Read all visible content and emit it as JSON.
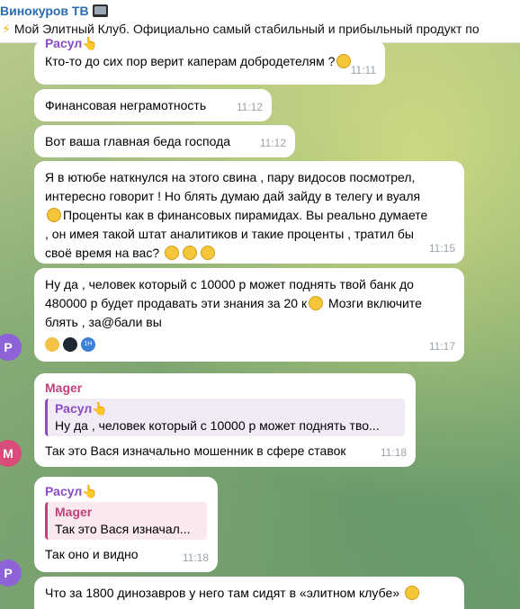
{
  "header": {
    "title": "Винокуров ТВ",
    "subtitle": "Мой Элитный Клуб. Официально самый стабильный и прибыльный продукт по"
  },
  "messages": [
    {
      "text": "Кто-то до сих пор верит каперам добродетелям ?",
      "time": "11:11"
    },
    {
      "text": "Финансовая неграмотность",
      "time": "11:12"
    },
    {
      "text": "Вот ваша главная беда господа",
      "time": "11:12"
    },
    {
      "lines": [
        "Я в ютюбе наткнулся на этого свина , пару видосов посмотрел,",
        "интересно говорит ! Но блять думаю дай зайду в телегу и вуаля",
        "Проценты как в финансовых пирамидах. Вы реально думаете",
        ", он имея такой штат аналитиков и такие проценты , тратил бы",
        "своё время на вас?"
      ],
      "time": "11:15"
    },
    {
      "lines": [
        "Ну да , человек который с 10000 р может поднять твой банк до",
        "480000 р будет продавать эти знания за 20 к",
        " Мозги включите",
        "блять , за@бали вы"
      ],
      "time": "11:17"
    },
    {
      "sender": "Mager",
      "reply_name": "Расул",
      "reply_text": "Ну да , человек который с 10000 р может поднять тво...",
      "text": "Так это Вася изначально мошенник в сфере ставок",
      "time": "11:18"
    },
    {
      "sender": "Расул",
      "reply_name": "Mager",
      "reply_text": "Так это Вася изначал...",
      "text": "Так оно и видно",
      "time": "11:18"
    },
    {
      "text": "Что за 1800 динозавров у него там сидят в «элитном клубе»"
    }
  ],
  "top_partial": {
    "sender": "Расул"
  },
  "avatars": {
    "p": "P",
    "m": "M"
  },
  "reaction_badge": "1H",
  "colors": {
    "header_title": "#2b6cb0",
    "mager": "#c0427a",
    "rasul": "#8a4bc8",
    "bubble": "#ffffff"
  }
}
